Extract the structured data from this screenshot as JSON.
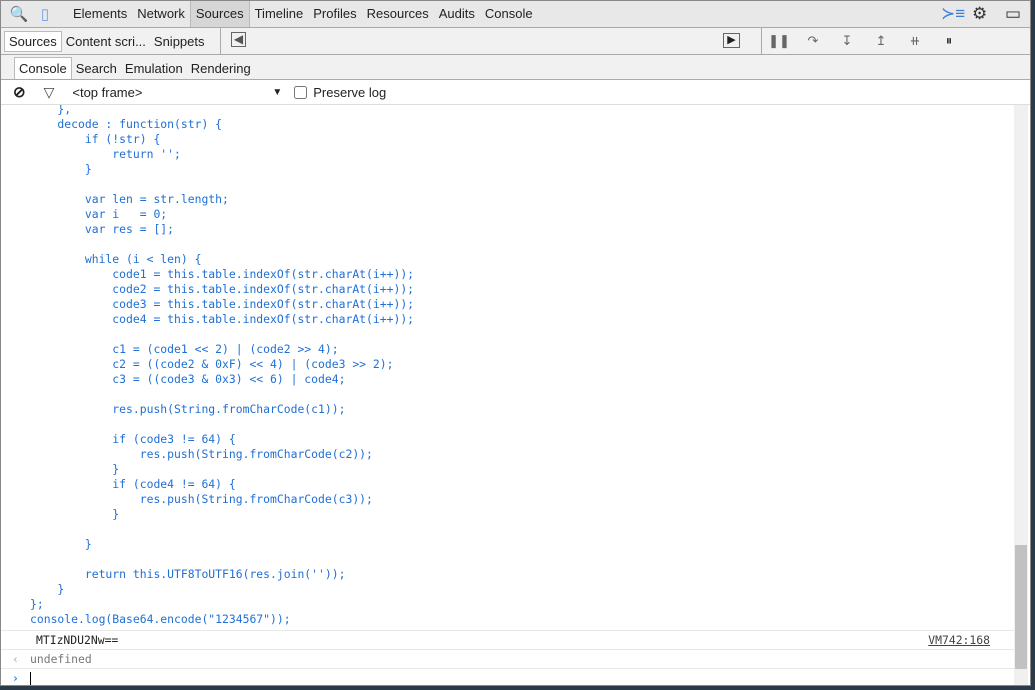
{
  "main_tabs": [
    "Elements",
    "Network",
    "Sources",
    "Timeline",
    "Profiles",
    "Resources",
    "Audits",
    "Console"
  ],
  "active_main_tab": "Sources",
  "nav_tabs": [
    "Sources",
    "Content scri...",
    "Snippets"
  ],
  "drawer_tabs": [
    "Console",
    "Search",
    "Emulation",
    "Rendering"
  ],
  "filter": {
    "frame": "<top frame>",
    "preserve_log": "Preserve log",
    "preserve_checked": false
  },
  "code": "    },\n    decode : function(str) {\n        if (!str) {\n            return '';\n        }\n\n        var len = str.length;\n        var i   = 0;\n        var res = [];\n\n        while (i < len) {\n            code1 = this.table.indexOf(str.charAt(i++));\n            code2 = this.table.indexOf(str.charAt(i++));\n            code3 = this.table.indexOf(str.charAt(i++));\n            code4 = this.table.indexOf(str.charAt(i++));\n\n            c1 = (code1 << 2) | (code2 >> 4);\n            c2 = ((code2 & 0xF) << 4) | (code3 >> 2);\n            c3 = ((code3 & 0x3) << 6) | code4;\n\n            res.push(String.fromCharCode(c1));\n\n            if (code3 != 64) {\n                res.push(String.fromCharCode(c2));\n            }\n            if (code4 != 64) {\n                res.push(String.fromCharCode(c3));\n            }\n\n        }\n\n        return this.UTF8ToUTF16(res.join(''));\n    }\n};\nconsole.log(Base64.encode(\"1234567\"));",
  "output": {
    "text": "MTIzNDU2Nw==",
    "source": "VM742:168"
  },
  "result": "undefined",
  "colors": {
    "code": "#1f6fd6",
    "accent": "#3b7ddd"
  }
}
